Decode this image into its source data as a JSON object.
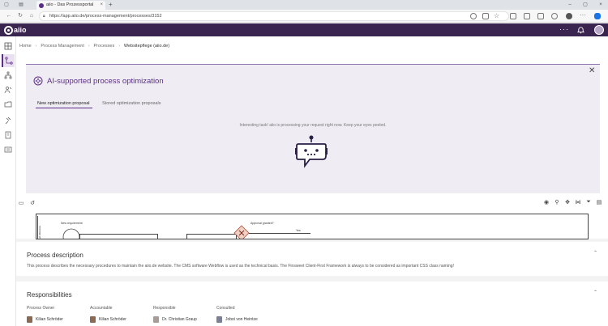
{
  "browser": {
    "tab_title": "aiio - Das Prozessportal",
    "url": "https://app.aiio.de/process-management/processes/3152"
  },
  "app": {
    "logo_text": "aiio",
    "menu_dots": "···"
  },
  "breadcrumb": {
    "items": [
      "Home",
      "Process Management",
      "Processes",
      "Websitepflege (aiio.de)"
    ]
  },
  "ai_panel": {
    "title": "AI-supported process optimization",
    "tabs": [
      {
        "label": "New optimization proposal",
        "active": true
      },
      {
        "label": "Stored optimization proposals",
        "active": false
      }
    ],
    "message": "Interesting task! aiio is processing your request right now. Keep your eyes peeled."
  },
  "diagram": {
    "lane_label": "all Websites",
    "texts": [
      "New requirement",
      "Approval granted?",
      "Yes"
    ]
  },
  "process_description": {
    "title": "Process description",
    "text": "This process describes the necessary procedures to maintain the aiio.de website. The CMS software Webflow is used as the technical basis. The Finsweet Client-First Framework is always to be considered as important CSS class naming!"
  },
  "responsibilities": {
    "title": "Responsibilities",
    "roles": [
      {
        "label": "Process Owner",
        "person": "Kilian Schröder"
      },
      {
        "label": "Accountable",
        "person": "Kilian Schröder"
      },
      {
        "label": "Responsible",
        "person": "Dr. Christian Graup"
      },
      {
        "label": "Consulted",
        "person": "Jobst von Heintze"
      }
    ]
  },
  "colors": {
    "brand": "#3a2450",
    "accent": "#5b2d86",
    "panel_bg": "#efedf3"
  }
}
